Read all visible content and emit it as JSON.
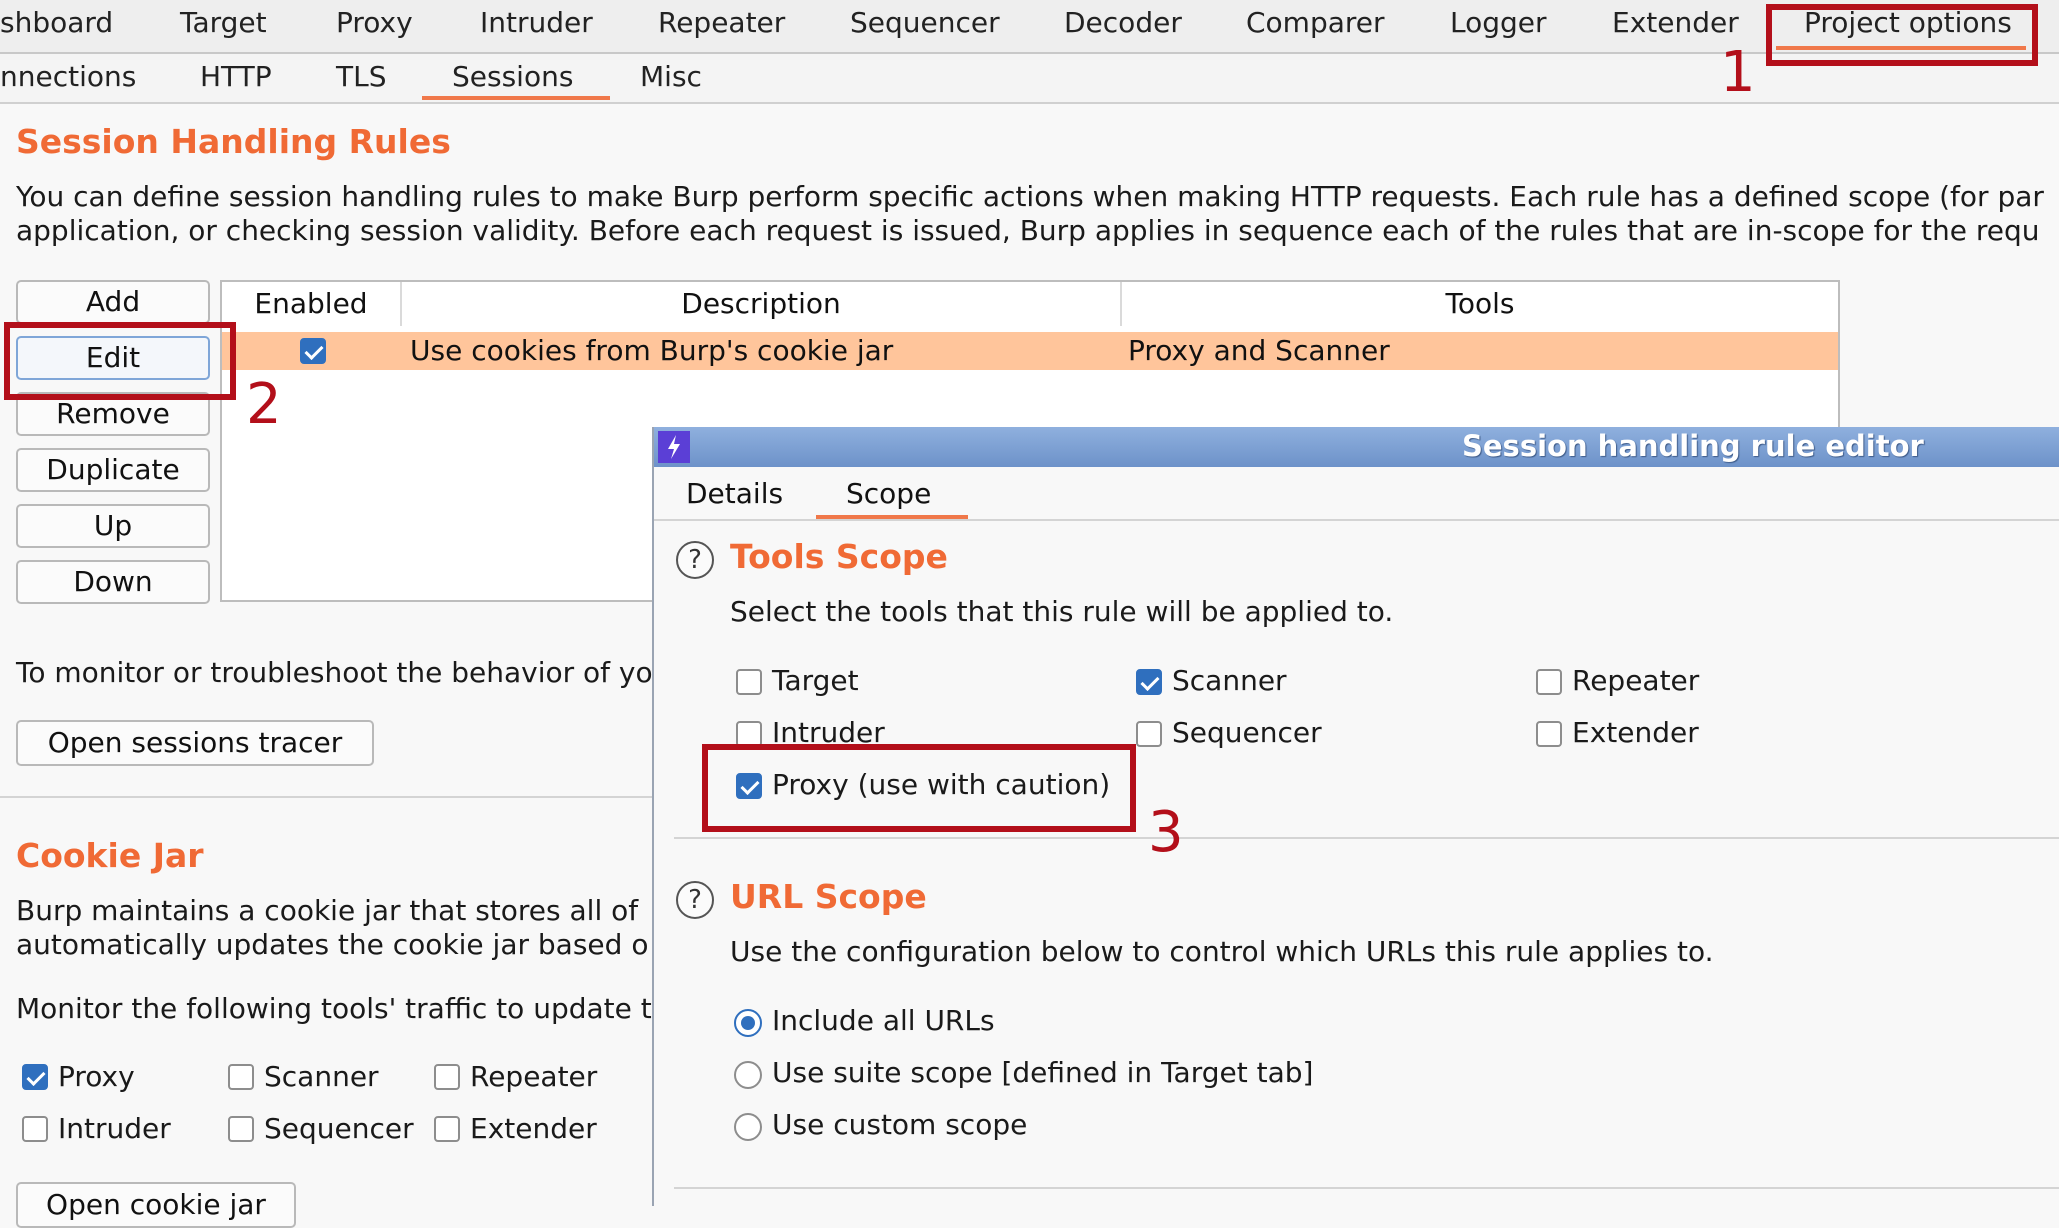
{
  "main_tabs": [
    "shboard",
    "Target",
    "Proxy",
    "Intruder",
    "Repeater",
    "Sequencer",
    "Decoder",
    "Comparer",
    "Logger",
    "Extender",
    "Project options"
  ],
  "sub_tabs": [
    "nnections",
    "HTTP",
    "TLS",
    "Sessions",
    "Misc"
  ],
  "session_rules": {
    "title": "Session Handling Rules",
    "desc_line1": "You can define session handling rules to make Burp perform specific actions when making HTTP requests. Each rule has a defined scope (for par",
    "desc_line2": "application, or checking session validity. Before each request is issued, Burp applies in sequence each of the rules that are in-scope for the requ",
    "buttons": [
      "Add",
      "Edit",
      "Remove",
      "Duplicate",
      "Up",
      "Down"
    ],
    "table": {
      "headers": [
        "Enabled",
        "Description",
        "Tools"
      ],
      "rows": [
        {
          "enabled": true,
          "description": "Use cookies from Burp's cookie jar",
          "tools": "Proxy and Scanner"
        }
      ]
    },
    "monitor_text": "To monitor or troubleshoot the behavior of yo",
    "tracer_button": "Open sessions tracer"
  },
  "cookie_jar": {
    "title": "Cookie Jar",
    "desc_line1": "Burp maintains a cookie jar that stores all of",
    "desc_line2": "automatically updates the cookie jar based o",
    "monitor_text": "Monitor the following tools' traffic to update t",
    "tools": [
      {
        "label": "Proxy",
        "checked": true
      },
      {
        "label": "Scanner",
        "checked": false
      },
      {
        "label": "Repeater",
        "checked": false
      },
      {
        "label": "Intruder",
        "checked": false
      },
      {
        "label": "Sequencer",
        "checked": false
      },
      {
        "label": "Extender",
        "checked": false
      }
    ],
    "open_button": "Open cookie jar"
  },
  "dialog": {
    "title": "Session handling rule editor",
    "tabs": [
      "Details",
      "Scope"
    ],
    "tools_scope": {
      "title": "Tools Scope",
      "desc": "Select the tools that this rule will be applied to.",
      "tools": [
        {
          "label": "Target",
          "checked": false
        },
        {
          "label": "Scanner",
          "checked": true
        },
        {
          "label": "Repeater",
          "checked": false
        },
        {
          "label": "Intruder",
          "checked": false
        },
        {
          "label": "Sequencer",
          "checked": false
        },
        {
          "label": "Extender",
          "checked": false
        },
        {
          "label": "Proxy (use with caution)",
          "checked": true
        }
      ]
    },
    "url_scope": {
      "title": "URL Scope",
      "desc": "Use the configuration below to control which URLs this rule applies to.",
      "options": [
        {
          "label": "Include all URLs",
          "selected": true
        },
        {
          "label": "Use suite scope [defined in Target tab]",
          "selected": false
        },
        {
          "label": "Use custom scope",
          "selected": false
        }
      ]
    }
  },
  "annotations": [
    "1",
    "2",
    "3"
  ],
  "colors": {
    "accent": "#f06a35",
    "selected_row": "#ffc59b",
    "annotation": "#b30f1a",
    "checkbox": "#2f6fbe"
  }
}
